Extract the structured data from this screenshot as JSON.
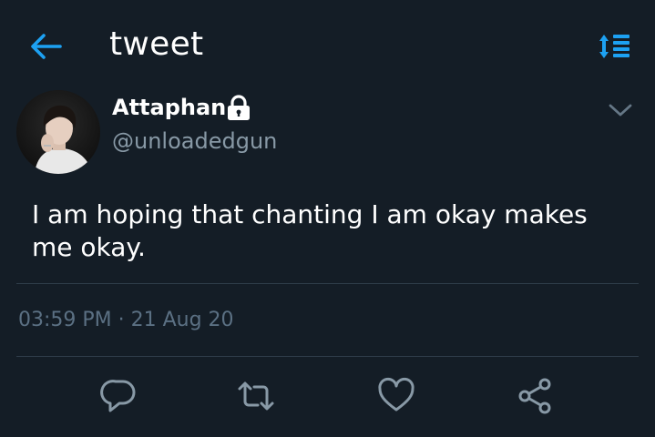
{
  "header": {
    "title": "tweet",
    "back_icon": "arrow-left-icon",
    "sort_icon": "sort-list-icon"
  },
  "tweet": {
    "author": {
      "name": "Attaphan",
      "handle": "@unloadedgun",
      "protected_icon": "lock-icon"
    },
    "text": "I am hoping that chanting I am okay makes me okay.",
    "timestamp": "03:59 PM · 21 Aug 20"
  },
  "actions": {
    "reply_icon": "reply-icon",
    "retweet_icon": "retweet-icon",
    "like_icon": "heart-icon",
    "share_icon": "share-icon"
  },
  "colors": {
    "background": "#141d26",
    "accent": "#1da1f2",
    "secondary_text": "#8899a6",
    "icon_gray": "#8899a6",
    "divider": "#2f3d4a"
  }
}
